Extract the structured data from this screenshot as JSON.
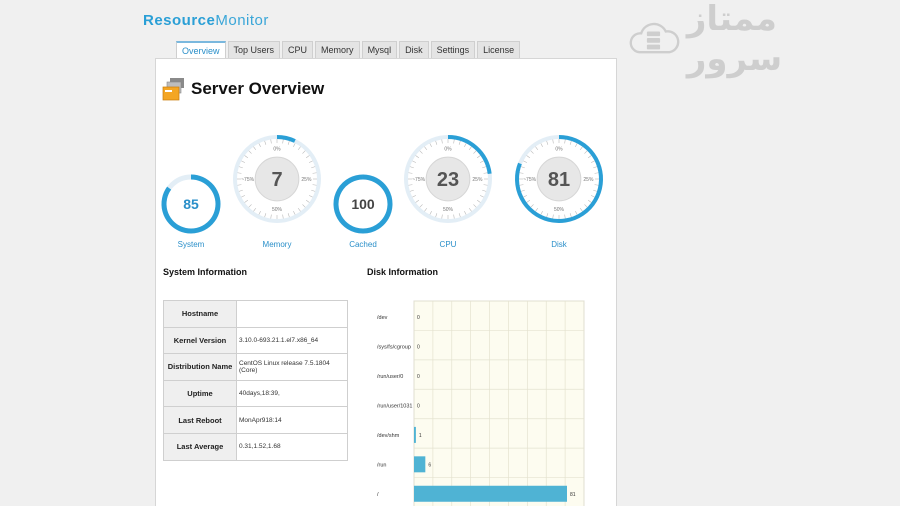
{
  "brand": {
    "part1": "Resource",
    "part2": "Monitor"
  },
  "watermark": {
    "text": "ممتاز سرور"
  },
  "tabs": [
    "Overview",
    "Top Users",
    "CPU",
    "Memory",
    "Mysql",
    "Disk",
    "Settings",
    "License"
  ],
  "active_tab": "Overview",
  "page_title": "Server Overview",
  "gauges": [
    {
      "name": "System",
      "value": 85,
      "fraction": 0.85,
      "style": "small"
    },
    {
      "name": "Memory",
      "value": 7,
      "fraction": 0.07,
      "style": "large"
    },
    {
      "name": "Cached",
      "value": 100,
      "fraction": 1.0,
      "style": "small"
    },
    {
      "name": "CPU",
      "value": 23,
      "fraction": 0.23,
      "style": "large"
    },
    {
      "name": "Disk",
      "value": 81,
      "fraction": 0.81,
      "style": "large"
    }
  ],
  "gauge_ticks": [
    "0%",
    "25%",
    "50%",
    "~75%"
  ],
  "system_info": {
    "title": "System Information",
    "rows": [
      {
        "key": "Hostname",
        "value": ""
      },
      {
        "key": "Kernel Version",
        "value": "3.10.0-693.21.1.el7.x86_64"
      },
      {
        "key": "Distribution Name",
        "value": "CentOS Linux release 7.5.1804 (Core)"
      },
      {
        "key": "Uptime",
        "value": "40days,18:39,"
      },
      {
        "key": "Last Reboot",
        "value": "MonApr918:14"
      },
      {
        "key": "Last Average",
        "value": "0.31,1.52,1.68"
      }
    ]
  },
  "chart_data": {
    "type": "bar",
    "orientation": "horizontal",
    "title": "Disk Information",
    "categories": [
      "/dev",
      "/sys/fs/cgroup",
      "/run/user/0",
      "/run/user/1031",
      "/dev/shm",
      "/run",
      "/"
    ],
    "values": [
      0,
      0,
      0,
      0,
      1,
      6,
      81
    ],
    "xlim": [
      0,
      90
    ],
    "xticks": [
      0,
      10,
      20,
      30,
      40,
      50,
      60,
      70,
      80,
      90
    ],
    "grid": true,
    "bar_color": "#4fb3d4",
    "background": "#fdfcf0"
  },
  "colors": {
    "accent": "#2a8fc9",
    "ring": "#2a9fd6"
  }
}
